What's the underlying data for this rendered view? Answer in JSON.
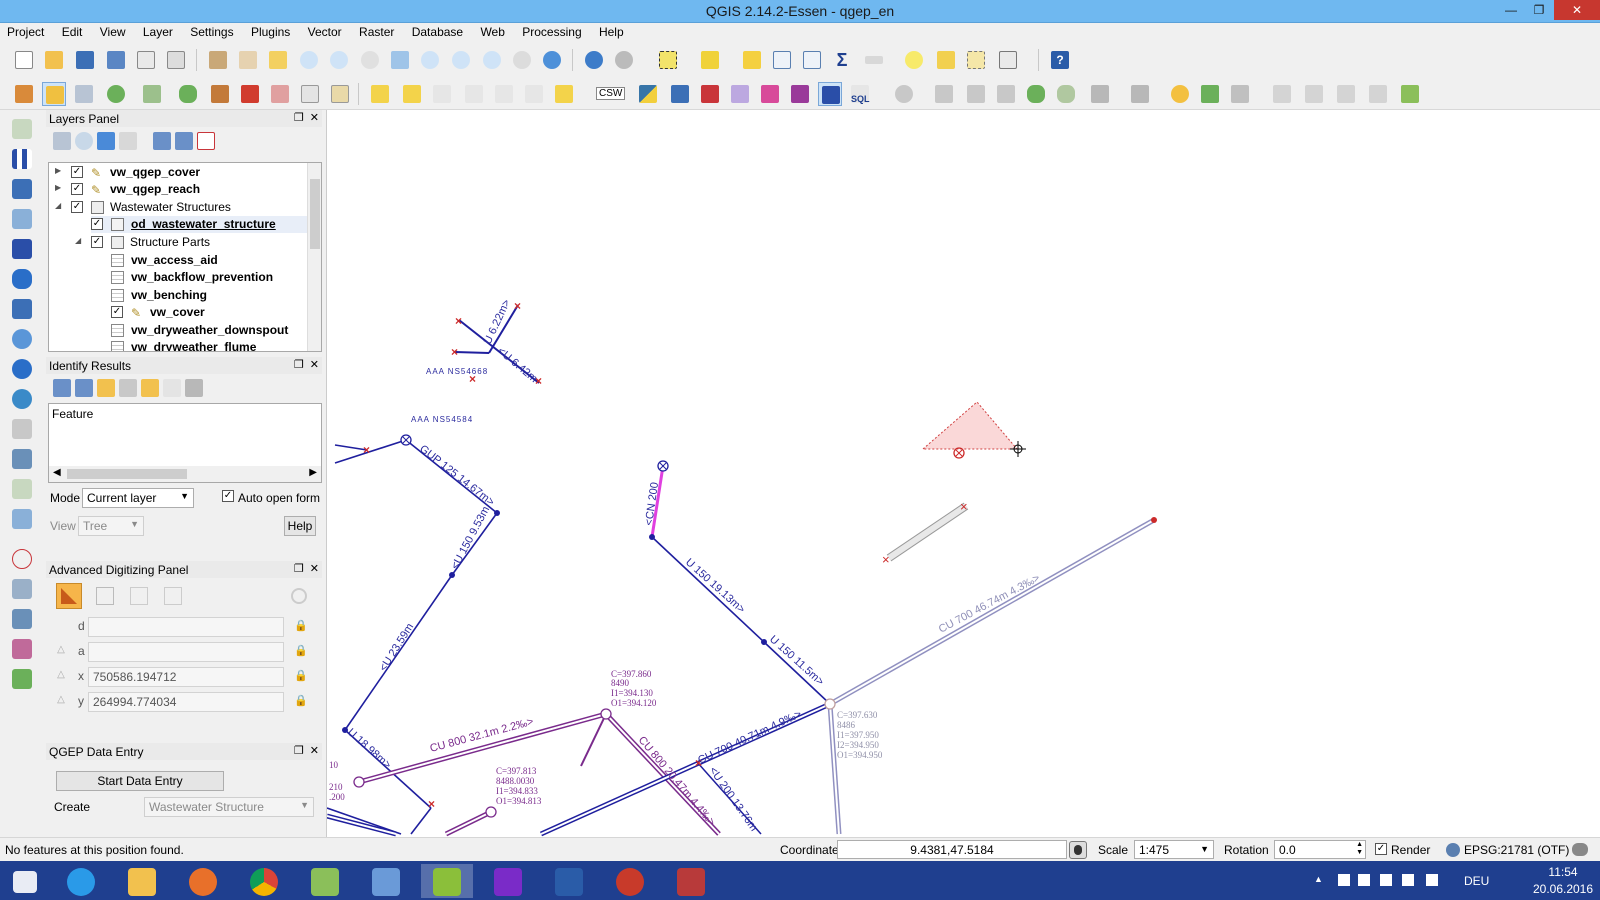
{
  "window": {
    "title": "QGIS 2.14.2-Essen - qgep_en",
    "minimize": "—",
    "maximize": "❐",
    "close": "✕"
  },
  "menu": [
    "Project",
    "Edit",
    "View",
    "Layer",
    "Settings",
    "Plugins",
    "Vector",
    "Raster",
    "Database",
    "Web",
    "Processing",
    "Help"
  ],
  "toolbar_labels": {
    "csw": "CSW",
    "sql": "SQL"
  },
  "layers_panel": {
    "title": "Layers Panel",
    "items": [
      {
        "label": "vw_qgep_cover",
        "checked": true,
        "bold": true
      },
      {
        "label": "vw_qgep_reach",
        "checked": true,
        "bold": true
      },
      {
        "label": "Wastewater Structures",
        "checked": true,
        "bold": false
      },
      {
        "label": "od_wastewater_structure",
        "checked": true,
        "bold": true
      },
      {
        "label": "Structure Parts",
        "checked": true,
        "bold": false
      },
      {
        "label": "vw_access_aid",
        "checked": false,
        "bold": true
      },
      {
        "label": "vw_backflow_prevention",
        "checked": false,
        "bold": true
      },
      {
        "label": "vw_benching",
        "checked": false,
        "bold": true
      },
      {
        "label": "vw_cover",
        "checked": true,
        "bold": true
      },
      {
        "label": "vw_dryweather_downspout",
        "checked": false,
        "bold": true
      },
      {
        "label": "vw_dryweather_flume",
        "checked": false,
        "bold": true
      }
    ]
  },
  "identify_panel": {
    "title": "Identify Results",
    "feature_header": "Feature",
    "mode_label": "Mode",
    "mode_value": "Current layer",
    "auto_open_label": "Auto open form",
    "auto_open_checked": true,
    "view_label": "View",
    "view_value": "Tree",
    "help_label": "Help"
  },
  "adv_panel": {
    "title": "Advanced Digitizing Panel",
    "fields": [
      {
        "label": "d",
        "value": ""
      },
      {
        "label": "a",
        "value": ""
      },
      {
        "label": "x",
        "value": "750586.194712"
      },
      {
        "label": "y",
        "value": "264994.774034"
      }
    ]
  },
  "qgep_panel": {
    "title": "QGEP Data Entry",
    "start_button": "Start Data Entry",
    "create_label": "Create",
    "create_value": "Wastewater Structure"
  },
  "map": {
    "labels": {
      "aaa1": "AAA NS54668",
      "aaa2": "AAA NS54584",
      "u622": "U 6.22m>",
      "u642": "<U 6.42m",
      "gup": "GUP 125 14.67m>",
      "u150_953": "<U 150 9.53m",
      "u2359": "<U 23.59m",
      "u1898": "U 18.98m>",
      "cn200": "<CN 200",
      "u150_1913": "U 150 19.13m>",
      "u150_115": "U 150 11.5m>",
      "cu700_4674": "CU 700 46.74m 4.3‰>",
      "cu700_4071": "CU 700 40.71m 4.9‰>",
      "cu800_321": "CU 800 32.1m 2.2‰>",
      "cu800_2047": "CU 800 20.47m 4.4‰>",
      "u200": "<U 200 13.76m",
      "left10": "10",
      "left210": "210",
      "left200": ".200"
    },
    "node_a": [
      "C=397.860",
      "8490",
      "I1=394.130",
      "O1=394.120"
    ],
    "node_b": [
      "C=397.813",
      "8488.0030",
      "I1=394.833",
      "O1=394.813"
    ],
    "node_c": [
      "C=397.630",
      "8486",
      "I1=397.950",
      "I2=394.950",
      "O1=394.950"
    ]
  },
  "status": {
    "message": "No features at this position found.",
    "coordinate_label": "Coordinate",
    "coordinate_value": "9.4381,47.5184",
    "scale_label": "Scale",
    "scale_value": "1:475",
    "rotation_label": "Rotation",
    "rotation_value": "0.0",
    "render_label": "Render",
    "render_checked": true,
    "crs": "EPSG:21781 (OTF)"
  },
  "taskbar": {
    "lang": "DEU",
    "time": "11:54",
    "date": "20.06.2016"
  },
  "colors": {
    "titlebar": "#6fb8f0",
    "taskbar": "#1f3f8f",
    "pipe_blue": "#1f1f9e",
    "pipe_purple": "#7a2b8c",
    "pipe_magenta": "#e040e0",
    "pipe_gray": "#9090c0",
    "node_red": "#cc2a2a"
  }
}
